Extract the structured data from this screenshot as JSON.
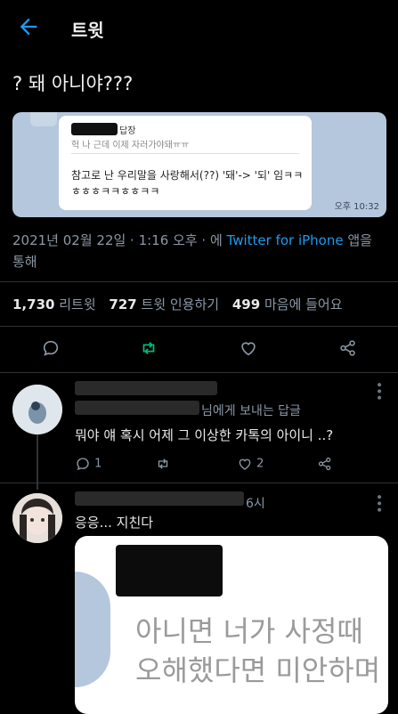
{
  "header": {
    "title": "트윗"
  },
  "tweet": {
    "text": "? 돼 아니야???",
    "image": {
      "reply_label": "답장",
      "quote": "헉 나 근데 이제 자러가야돼ㅠㅠ",
      "message": "참고로 난 우리말을 사랑해서(??) '돼'-> '되' 임ㅋㅋㅎㅎㅎㅋㅋㅎㅎㅋㅋ",
      "time": "오후 10:32"
    },
    "meta": {
      "date": "2021년 02월 22일 · 1:16 오후 · 에 ",
      "via": "Twitter for iPhone",
      "suffix": " 앱을 통해"
    },
    "stats": {
      "retweets": "1,730",
      "retweets_label": "리트윗",
      "quotes": "727",
      "quotes_label": "트윗 인용하기",
      "likes": "499",
      "likes_label": "마음에 들어요"
    }
  },
  "replies": [
    {
      "to": "님에게 보내는 답글",
      "text": "뭐야 얘 혹시 어제 그 이상한 카톡의 아이니 ..?",
      "reply_count": "1",
      "like_count": "2"
    },
    {
      "time_suffix": "6시",
      "text": "응응... 지친다",
      "image": {
        "line1": "아니면 너가 사정때",
        "line2": "오해했다면 미안하며"
      }
    }
  ],
  "colors": {
    "accent": "#1d9bf0",
    "retweet": "#00ba7c",
    "muted": "#8b98a5"
  }
}
